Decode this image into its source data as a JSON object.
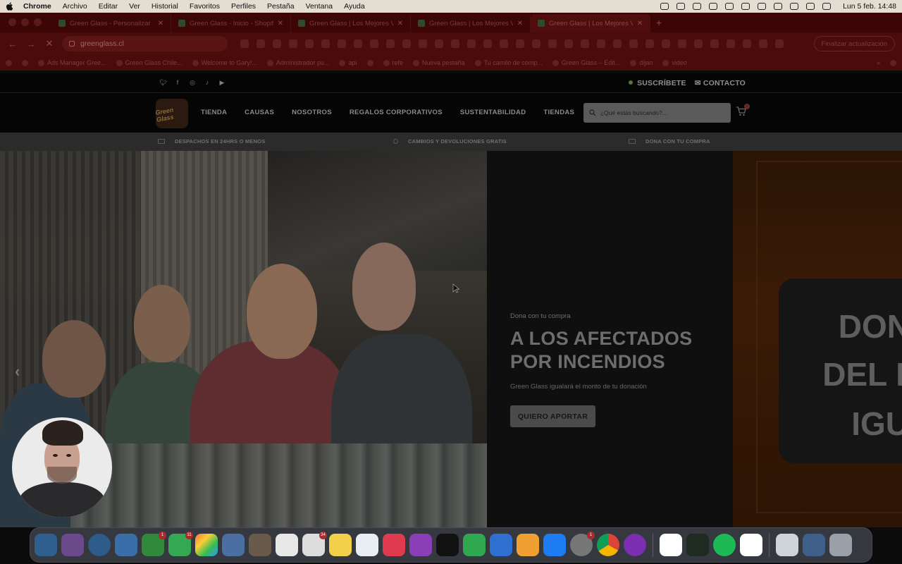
{
  "menubar": {
    "app": "Chrome",
    "items": [
      "Archivo",
      "Editar",
      "Ver",
      "Historial",
      "Favoritos",
      "Perfiles",
      "Pestaña",
      "Ventana",
      "Ayuda"
    ],
    "clock": "Lun 5 feb.  14:48"
  },
  "tabs": [
    {
      "title": "Green Glass - Personalizar ★"
    },
    {
      "title": "Green Glass - Inicio - Shopify"
    },
    {
      "title": "Green Glass | Los Mejores Va"
    },
    {
      "title": "Green Glass | Los Mejores Va"
    },
    {
      "title": "Green Glass | Los Mejores Va"
    }
  ],
  "toolbar": {
    "url": "greenglass.cl",
    "update_label": "Finalizar actualización"
  },
  "bookmarks": [
    "Ads Manager Gree...",
    "Green Glass Chile...",
    "Welcome to Gary!...",
    "Administrador pu...",
    "api",
    "refe",
    "Nueva pestaña",
    "Tu camilo de comp...",
    "Green Glass – Edit...",
    "dijan",
    "video"
  ],
  "site": {
    "toplinks": {
      "subscribe": "SUSCRÍBETE",
      "contact": "CONTACTO"
    },
    "logo_text": "Green Glass",
    "nav": [
      "TIENDA",
      "CAUSAS",
      "NOSOTROS",
      "REGALOS CORPORATIVOS",
      "SUSTENTABILIDAD",
      "TIENDAS"
    ],
    "search_placeholder": "¿Qué estás buscando?...",
    "cart_count": "0",
    "benefits": [
      "DESPACHOS EN 24HRS O MENOS",
      "CAMBIOS Y DEVOLUCIONES GRATIS",
      "DONA CON TU COMPRA"
    ],
    "hero": {
      "eyebrow": "Dona con tu compra",
      "title": "A LOS AFECTADOS POR INCENDIOS",
      "subtitle": "Green Glass igualará el monto de tu donación",
      "cta": "QUIERO APORTAR",
      "next_slide_lines": [
        "DON",
        "DEL I",
        "IGU"
      ]
    }
  },
  "dock_badges": {
    "mail": "",
    "facetime": "1",
    "messages": "11",
    "reminders": "34",
    "settings": "1"
  }
}
